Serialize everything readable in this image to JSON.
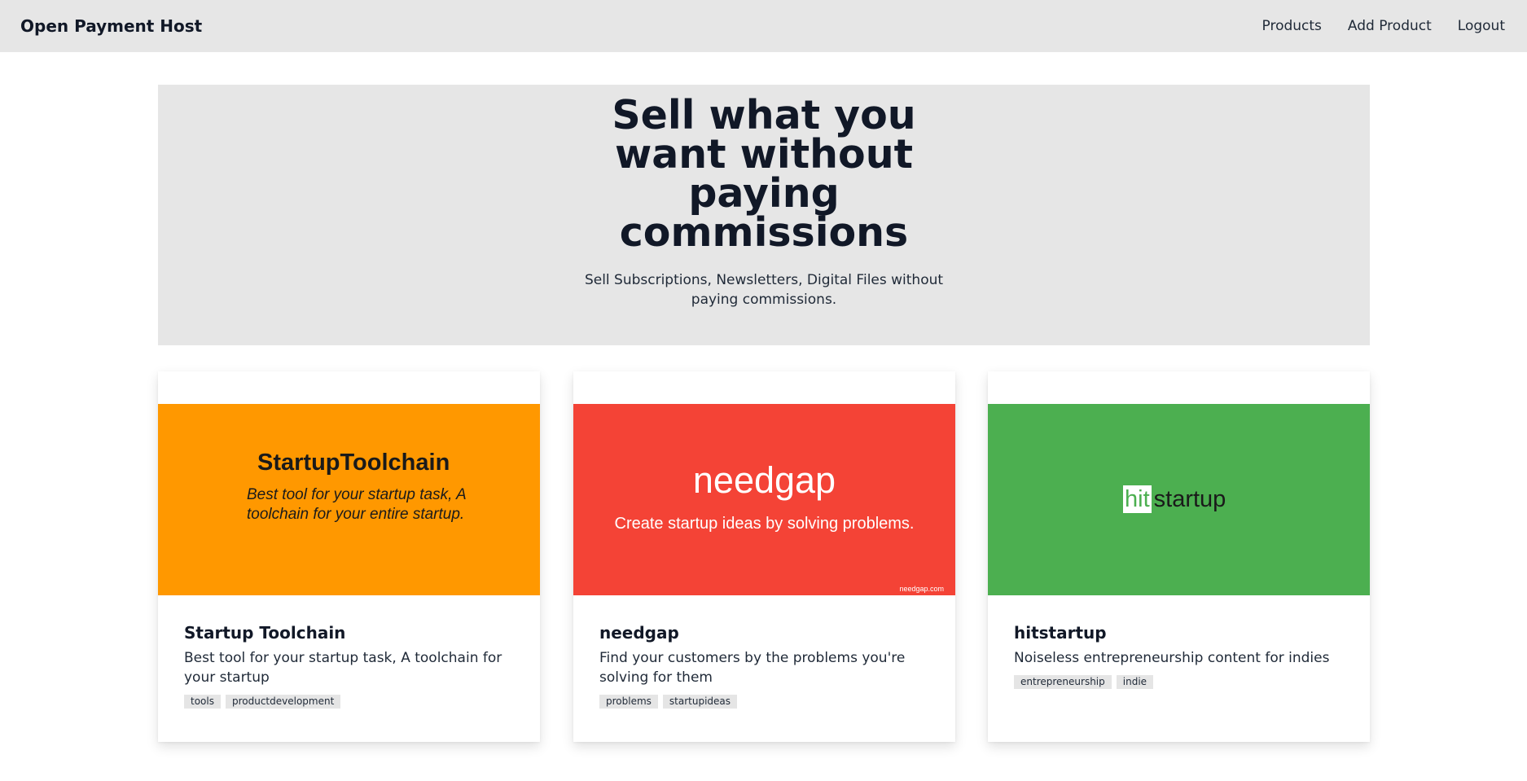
{
  "nav": {
    "brand": "Open Payment Host",
    "links": [
      "Products",
      "Add Product",
      "Logout"
    ]
  },
  "hero": {
    "title": "Sell what you want without paying commissions",
    "subtitle": "Sell Subscriptions, Newsletters, Digital Files without paying commissions."
  },
  "products": [
    {
      "title": "Startup Toolchain",
      "description": "Best tool for your startup task, A toolchain for your startup",
      "tags": [
        "tools",
        "productdevelopment"
      ],
      "banner": {
        "color": "#ff9800",
        "heading": "StartupToolchain",
        "tagline": "Best tool for your startup task, A toolchain for your entire startup."
      }
    },
    {
      "title": "needgap",
      "description": "Find your customers by the problems you're solving for them",
      "tags": [
        "problems",
        "startupideas"
      ],
      "banner": {
        "color": "#f44336",
        "heading": "needgap",
        "tagline": "Create startup ideas by solving problems.",
        "url": "needgap.com"
      }
    },
    {
      "title": "hitstartup",
      "description": "Noiseless entrepreneurship content for indies",
      "tags": [
        "entrepreneurship",
        "indie"
      ],
      "banner": {
        "color": "#4caf50",
        "logo_highlight": "hit",
        "logo_rest": "startup"
      }
    }
  ]
}
